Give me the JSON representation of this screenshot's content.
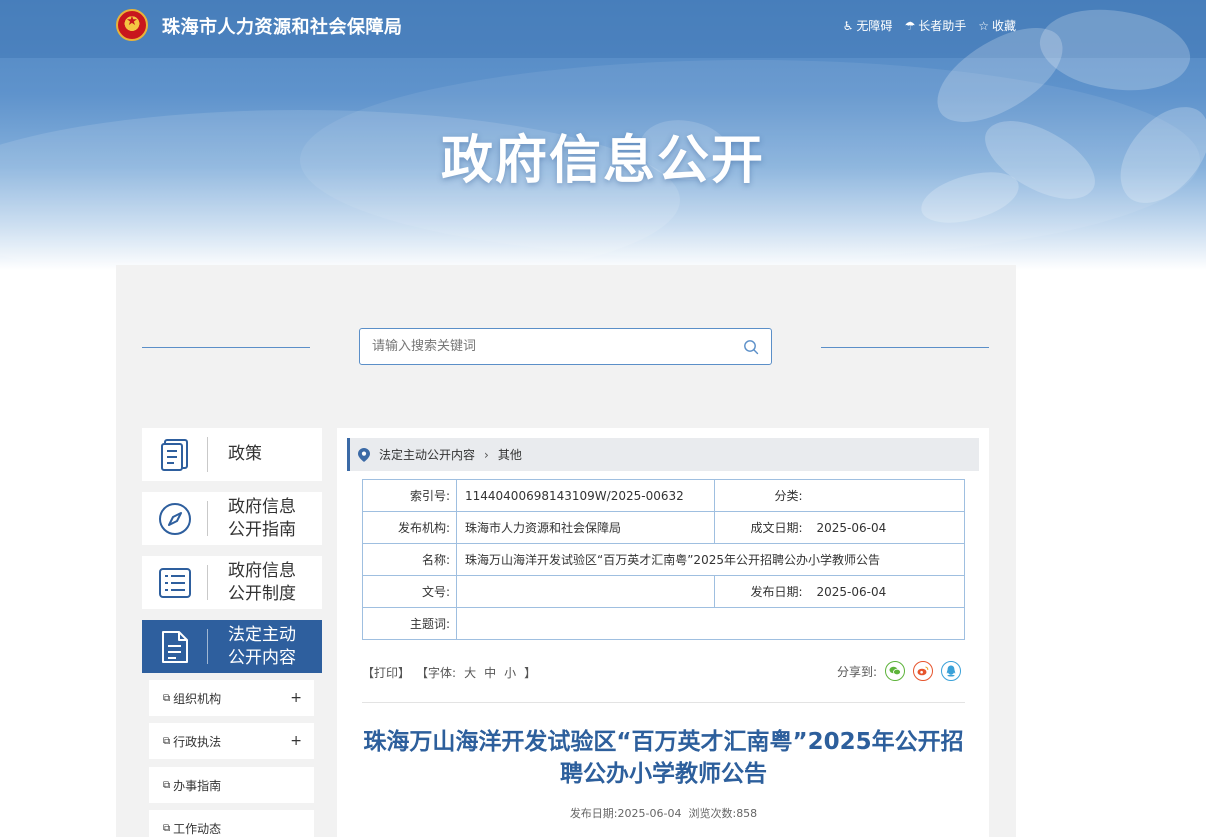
{
  "header": {
    "site_name": "珠海市人力资源和社会保障局",
    "links": [
      {
        "icon": "wheelchair-icon",
        "glyph": "♿",
        "label": "无障碍"
      },
      {
        "icon": "elder-assist-icon",
        "glyph": "☂",
        "label": "长者助手"
      },
      {
        "icon": "star-icon",
        "glyph": "☆",
        "label": "收藏"
      }
    ],
    "banner_title": "政府信息公开"
  },
  "search": {
    "placeholder": "请输入搜索关键词"
  },
  "sidebar": {
    "nav": [
      {
        "label": "政策",
        "icon": "document-book-icon"
      },
      {
        "label": "政府信息\n公开指南",
        "icon": "compass-icon"
      },
      {
        "label": "政府信息\n公开制度",
        "icon": "list-icon"
      },
      {
        "label": "法定主动\n公开内容",
        "icon": "file-icon",
        "active": true
      }
    ],
    "sub_items": [
      {
        "label": "组织机构",
        "expand": "+"
      },
      {
        "label": "行政执法",
        "expand": "+"
      },
      {
        "label": "办事指南",
        "expand": ""
      },
      {
        "label": "工作动态",
        "expand": ""
      }
    ]
  },
  "breadcrumb": {
    "level1": "法定主动公开内容",
    "separator": "›",
    "level2": "其他"
  },
  "meta_table": {
    "index_no_label": "索引号:",
    "index_no": "11440400698143109W/2025-00632",
    "category_label": "分类:",
    "category": "",
    "publisher_label": "发布机构:",
    "publisher": "珠海市人力资源和社会保障局",
    "written_date_label": "成文日期:",
    "written_date": "2025-06-04",
    "name_label": "名称:",
    "name": "珠海万山海洋开发试验区“百万英才汇南粤”2025年公开招聘公办小学教师公告",
    "doc_no_label": "文号:",
    "doc_no": "",
    "publish_date_label": "发布日期:",
    "publish_date": "2025-06-04",
    "keywords_label": "主题词:",
    "keywords": ""
  },
  "tools": {
    "print": "【打印】",
    "font_prefix": "【字体:",
    "font_large": "大",
    "font_medium": "中",
    "font_small": "小",
    "font_suffix": "】",
    "share_label": "分享到:"
  },
  "article": {
    "title": "珠海万山海洋开发试验区“百万英才汇南粤”2025年公开招聘公办小学教师公告",
    "meta_date_label": "发布日期:",
    "meta_date": "2025-06-04",
    "views_label": "浏览次数:",
    "views": "858"
  },
  "colors": {
    "accent": "#2e5f9e",
    "title_blue": "#2d5f9c",
    "wechat": "#5db33a",
    "weibo": "#e6542c",
    "qq": "#3aa1d8"
  }
}
